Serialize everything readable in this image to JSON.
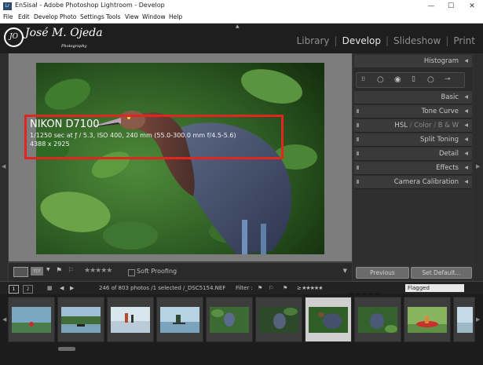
{
  "window": {
    "title": "EnSisal - Adobe Photoshop Lightroom - Develop",
    "icon_label": "Lr",
    "minimize_glyph": "—",
    "maximize_glyph": "☐",
    "close_glyph": "✕"
  },
  "menu": [
    "File",
    "Edit",
    "Develop",
    "Photo",
    "Settings",
    "Tools",
    "View",
    "Window",
    "Help"
  ],
  "identity_plate": {
    "monogram": "JO",
    "name": "José M. Ojeda",
    "tagline": "Photography"
  },
  "modules": [
    "Library",
    "Develop",
    "Slideshow",
    "Print"
  ],
  "active_module": "Develop",
  "photo_info": {
    "camera": "NIKON D7100",
    "exposure": "1/1250 sec at ƒ / 5.3, ISO 400, 240 mm (55.0-300.0 mm f/4.5-5.6)",
    "dimensions": "4388 x 2925"
  },
  "toolbar": {
    "yy_label": "Y|Y",
    "stars": "★★★★★",
    "soft_proofing": "Soft Proofing"
  },
  "right_panel": {
    "histogram": "Histogram",
    "basic": "Basic",
    "tone_curve": "Tone Curve",
    "hsl": {
      "hsl": "HSL",
      "sep": "/",
      "color": "Color",
      "bw": "B & W"
    },
    "split_toning": "Split Toning",
    "detail": "Detail",
    "effects": "Effects",
    "camera_calibration": "Camera Calibration",
    "previous_button": "Previous",
    "set_default_button": "Set Default..."
  },
  "filmstrip": {
    "view1": "1",
    "view2": "2",
    "count_text": "246 of 803 photos /1 selected /_DSC5154.NEF",
    "filter_label": "Filter :",
    "flag_filter": "Flagged",
    "thumb_count": 10,
    "selected_index": 6
  },
  "colors": {
    "accent_highlight": "#e0261f",
    "panel_bg": "#2f2f2f",
    "canvas_bg": "#7d7d7d"
  }
}
